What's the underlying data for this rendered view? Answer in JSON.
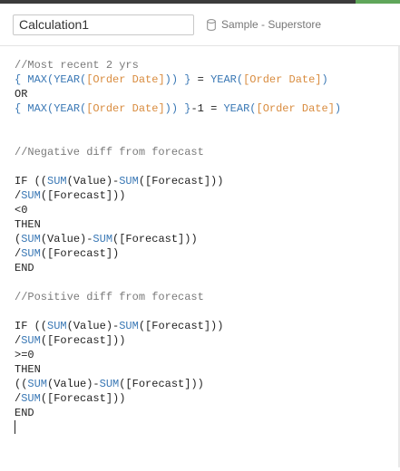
{
  "header": {
    "calc_name": "Calculation1",
    "datasource_label": "Sample - Superstore",
    "datasource_icon": "database-icon"
  },
  "colors": {
    "top_bar": "#3b3b3b",
    "top_bar_accent": "#5fa65a",
    "comment": "#7a7a7a",
    "function": "#3a78b5",
    "field": "#d98c3f",
    "plain": "#222222"
  },
  "code_lines": [
    [
      {
        "t": "comment",
        "v": "//Most recent 2 yrs"
      }
    ],
    [
      {
        "t": "fn",
        "v": "{ MAX("
      },
      {
        "t": "fn",
        "v": "YEAR("
      },
      {
        "t": "field",
        "v": "[Order Date]"
      },
      {
        "t": "fn",
        "v": ")) }"
      },
      {
        "t": "plain",
        "v": " = "
      },
      {
        "t": "fn",
        "v": "YEAR("
      },
      {
        "t": "field",
        "v": "[Order Date]"
      },
      {
        "t": "fn",
        "v": ")"
      }
    ],
    [
      {
        "t": "plain",
        "v": "OR"
      }
    ],
    [
      {
        "t": "fn",
        "v": "{ MAX("
      },
      {
        "t": "fn",
        "v": "YEAR("
      },
      {
        "t": "field",
        "v": "[Order Date]"
      },
      {
        "t": "fn",
        "v": ")) }"
      },
      {
        "t": "plain",
        "v": "-1 = "
      },
      {
        "t": "fn",
        "v": "YEAR("
      },
      {
        "t": "field",
        "v": "[Order Date]"
      },
      {
        "t": "fn",
        "v": ")"
      }
    ],
    [],
    [],
    [
      {
        "t": "comment",
        "v": "//Negative diff from forecast"
      }
    ],
    [],
    [
      {
        "t": "plain",
        "v": "IF (("
      },
      {
        "t": "fn",
        "v": "SUM"
      },
      {
        "t": "plain",
        "v": "(Value)-"
      },
      {
        "t": "fn",
        "v": "SUM"
      },
      {
        "t": "plain",
        "v": "([Forecast]))"
      }
    ],
    [
      {
        "t": "plain",
        "v": "/"
      },
      {
        "t": "fn",
        "v": "SUM"
      },
      {
        "t": "plain",
        "v": "([Forecast]))"
      }
    ],
    [
      {
        "t": "plain",
        "v": "<0"
      }
    ],
    [
      {
        "t": "plain",
        "v": "THEN"
      }
    ],
    [
      {
        "t": "plain",
        "v": "("
      },
      {
        "t": "fn",
        "v": "SUM"
      },
      {
        "t": "plain",
        "v": "(Value)-"
      },
      {
        "t": "fn",
        "v": "SUM"
      },
      {
        "t": "plain",
        "v": "([Forecast]))"
      }
    ],
    [
      {
        "t": "plain",
        "v": "/"
      },
      {
        "t": "fn",
        "v": "SUM"
      },
      {
        "t": "plain",
        "v": "([Forecast])"
      }
    ],
    [
      {
        "t": "plain",
        "v": "END"
      }
    ],
    [],
    [
      {
        "t": "comment",
        "v": "//Positive diff from forecast"
      }
    ],
    [],
    [
      {
        "t": "plain",
        "v": "IF (("
      },
      {
        "t": "fn",
        "v": "SUM"
      },
      {
        "t": "plain",
        "v": "(Value)-"
      },
      {
        "t": "fn",
        "v": "SUM"
      },
      {
        "t": "plain",
        "v": "([Forecast]))"
      }
    ],
    [
      {
        "t": "plain",
        "v": "/"
      },
      {
        "t": "fn",
        "v": "SUM"
      },
      {
        "t": "plain",
        "v": "([Forecast]))"
      }
    ],
    [
      {
        "t": "plain",
        "v": ">=0"
      }
    ],
    [
      {
        "t": "plain",
        "v": "THEN"
      }
    ],
    [
      {
        "t": "plain",
        "v": "(("
      },
      {
        "t": "fn",
        "v": "SUM"
      },
      {
        "t": "plain",
        "v": "(Value)-"
      },
      {
        "t": "fn",
        "v": "SUM"
      },
      {
        "t": "plain",
        "v": "([Forecast]))"
      }
    ],
    [
      {
        "t": "plain",
        "v": "/"
      },
      {
        "t": "fn",
        "v": "SUM"
      },
      {
        "t": "plain",
        "v": "([Forecast]))"
      }
    ],
    [
      {
        "t": "plain",
        "v": "END"
      }
    ]
  ]
}
